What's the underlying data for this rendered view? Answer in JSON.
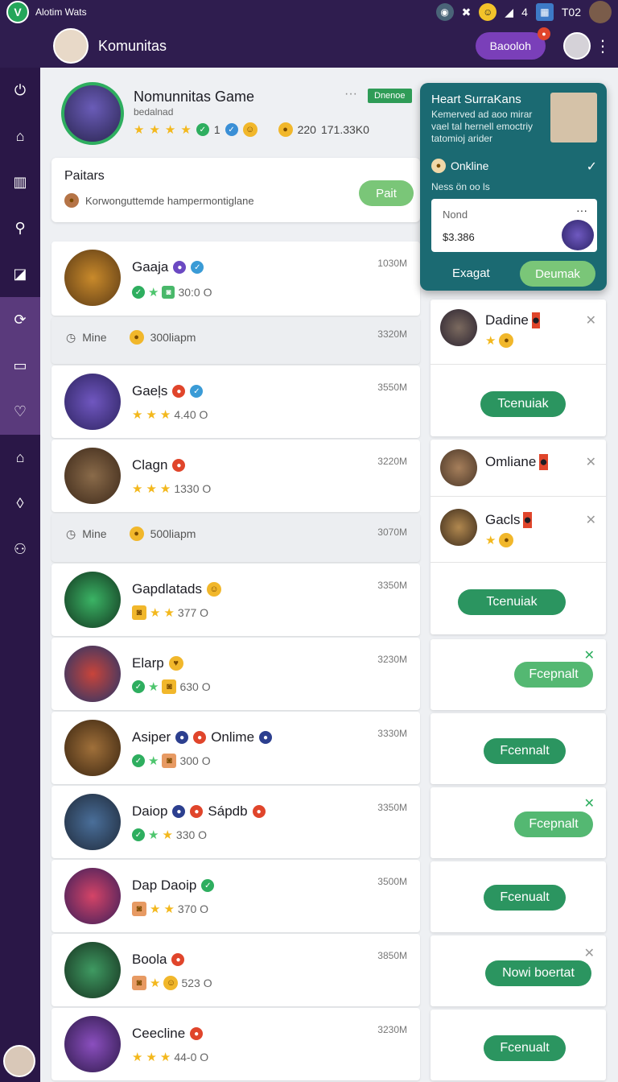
{
  "statusbar": {
    "app_letter": "V",
    "title": "Alotim Wats",
    "signal": "4",
    "time": "T02"
  },
  "header": {
    "title": "Komunitas",
    "pill": "Baooloh"
  },
  "profile": {
    "title": "Nomunnitas Game",
    "subtitle": "bedalnad",
    "stats": "1",
    "score": "220",
    "extra": "171.33K0",
    "tag": "Dnenoe"
  },
  "section": {
    "title": "Paitars",
    "desc": "Korwonguttemde hampermontiglane",
    "button": "Pait"
  },
  "rows": [
    {
      "name": "Gaaja",
      "meta": "30:0 O",
      "time": "1030M"
    },
    {
      "sep": true,
      "label": "Mine",
      "value": "300liapm",
      "time": "3320M"
    },
    {
      "name": "Gaeļs",
      "meta": "4.40 O",
      "time": "3550M"
    },
    {
      "name": "Clagn",
      "meta": "1330 O",
      "time": "3220M"
    },
    {
      "sep": true,
      "label": "Mine",
      "value": "500liapm",
      "time": "3070M"
    },
    {
      "name": "Gapdlatads",
      "meta": "377 O",
      "time": "3350M"
    },
    {
      "name": "Elarp",
      "meta": "630 O",
      "time": "3230M"
    },
    {
      "name": "Asiper",
      "name2": "Onlime",
      "meta": "300 O",
      "time": "3330M"
    },
    {
      "name": "Daiop",
      "name2": "Sápdb",
      "meta": "330 O",
      "time": "3350M"
    },
    {
      "name": "Dap Daoip",
      "meta": "370 O",
      "time": "3500M"
    },
    {
      "name": "Boola",
      "meta": "523 O",
      "time": "3850M"
    },
    {
      "name": "Ceecline",
      "meta": "44-0 O",
      "time": "3230M"
    }
  ],
  "popup": {
    "title": "Heart SurraKans",
    "desc": "Kemerved ad aoo mirar vael tal hernell emoctriy tatomioj arider",
    "status": "Onkline",
    "note": "Ness ön oo ls",
    "input_label": "Nond",
    "input_value": "$3.386",
    "left": "Exagat",
    "right": "Deumak"
  },
  "right": {
    "card1_name": "Dadine",
    "card1_btn": "Tcenuiak",
    "card2_name": "Omliane",
    "card3_name": "Gacls",
    "card3_btn": "Tcenuiak",
    "btn_a": "Fcepnalt",
    "btn_b": "Fcennalt",
    "btn_c": "Fcepnalt",
    "btn_d": "Fcenualt",
    "btn_e": "Nowi boertat",
    "btn_f": "Fcenualt"
  },
  "colors": {
    "sidebar": "#2a1747",
    "accent": "#2b9560",
    "popup": "#1b6a72"
  }
}
